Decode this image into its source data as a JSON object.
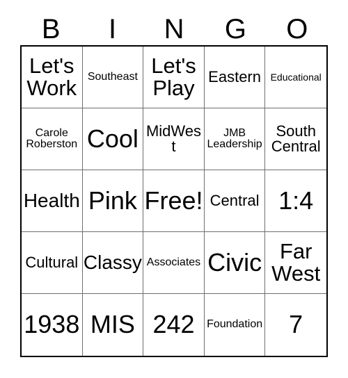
{
  "card": {
    "headers": [
      "B",
      "I",
      "N",
      "G",
      "O"
    ],
    "rows": [
      [
        {
          "text": "Let's Work",
          "size": "xl"
        },
        {
          "text": "Southeast",
          "size": "sm"
        },
        {
          "text": "Let's Play",
          "size": "xl"
        },
        {
          "text": "Eastern",
          "size": "md"
        },
        {
          "text": "Educational",
          "size": "xs"
        }
      ],
      [
        {
          "text": "Carole Roberston",
          "size": "sm"
        },
        {
          "text": "Cool",
          "size": "xxl"
        },
        {
          "text": "MidWest",
          "size": "md"
        },
        {
          "text": "JMB Leadership",
          "size": "sm"
        },
        {
          "text": "South Central",
          "size": "md"
        }
      ],
      [
        {
          "text": "Health",
          "size": "lg"
        },
        {
          "text": "Pink",
          "size": "xxl"
        },
        {
          "text": "Free!",
          "size": "xxl"
        },
        {
          "text": "Central",
          "size": "md"
        },
        {
          "text": "1:4",
          "size": "xxl"
        }
      ],
      [
        {
          "text": "Cultural",
          "size": "md"
        },
        {
          "text": "Classy",
          "size": "lg"
        },
        {
          "text": "Associates",
          "size": "sm"
        },
        {
          "text": "Civic",
          "size": "xxl"
        },
        {
          "text": "Far West",
          "size": "xl"
        }
      ],
      [
        {
          "text": "1938",
          "size": "xxl"
        },
        {
          "text": "MIS",
          "size": "xxl"
        },
        {
          "text": "242",
          "size": "xxl"
        },
        {
          "text": "Foundation",
          "size": "sm"
        },
        {
          "text": "7",
          "size": "xxl"
        }
      ]
    ]
  },
  "colors": {
    "text": "#000000",
    "background": "#ffffff",
    "outer_border": "#000000",
    "inner_border": "#6e6e6e"
  }
}
